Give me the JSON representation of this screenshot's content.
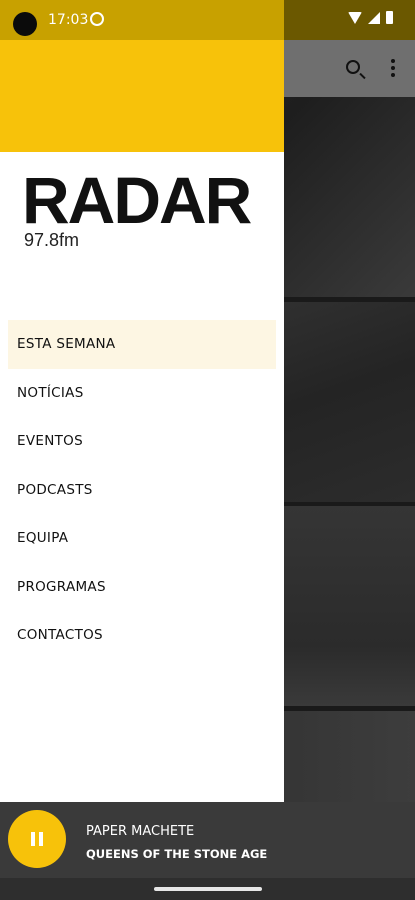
{
  "status": {
    "time": "17:03"
  },
  "brand": {
    "name": "RADAR",
    "frequency": "97.8fm"
  },
  "menu": {
    "items": [
      {
        "label": "ESTA SEMANA"
      },
      {
        "label": "NOTÍCIAS"
      },
      {
        "label": "EVENTOS"
      },
      {
        "label": "PODCASTS"
      },
      {
        "label": "EQUIPA"
      },
      {
        "label": "PROGRAMAS"
      },
      {
        "label": "CONTACTOS"
      }
    ]
  },
  "player": {
    "title": "PAPER MACHETE",
    "artist": "QUEENS OF THE STONE AGE",
    "state_icon": "pause-icon"
  },
  "toolbar": {
    "icons": [
      "search-icon",
      "more-vert-icon"
    ]
  },
  "colors": {
    "brand_yellow": "#F7C20A",
    "active_item_bg": "#FDF6E3",
    "player_bg": "#3A3A3A"
  }
}
